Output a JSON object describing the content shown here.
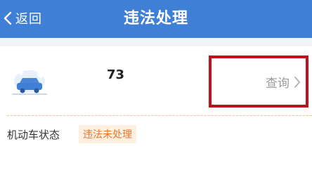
{
  "header": {
    "back_label": "返回",
    "title": "违法处理",
    "background_color": "#3f7fd6"
  },
  "vehicle": {
    "plate_text": "73",
    "icon": "car-icon",
    "query_label": "查询"
  },
  "status": {
    "label": "机动车状态",
    "badge": "违法未处理",
    "badge_color": "#e8772e",
    "badge_bg": "#fdf0e1"
  },
  "highlight": {
    "color": "#c0121b"
  }
}
